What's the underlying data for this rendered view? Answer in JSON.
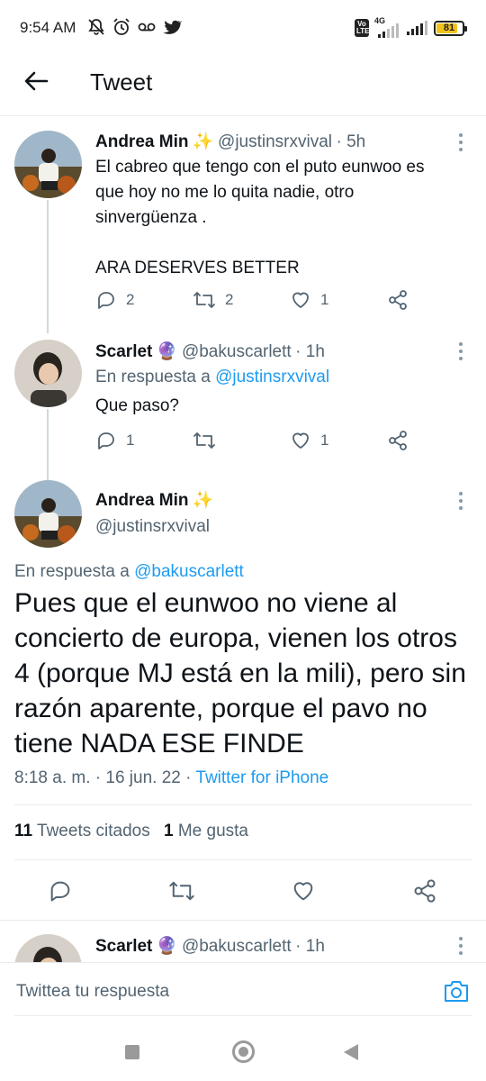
{
  "status_bar": {
    "time": "9:54 AM",
    "network": "4G",
    "volte": "Vo LTE",
    "battery": "81"
  },
  "header": {
    "title": "Tweet"
  },
  "tweets": [
    {
      "name": "Andrea Min",
      "emoji": "✨",
      "handle": "@justinsrxvival",
      "time": "· 5h",
      "lines": [
        "El cabreo que tengo con el puto eunwoo es",
        "que hoy no me lo quita nadie, otro",
        "sinvergüenza ."
      ],
      "extra": "ARA DESERVES BETTER",
      "replies": "2",
      "retweets": "2",
      "likes": "1"
    },
    {
      "name": "Scarlet",
      "emoji": "🔮",
      "handle": "@bakuscarlett",
      "time": "· 1h",
      "reply_prefix": "En respuesta a",
      "reply_to": "@justinsrxvival",
      "text": "Que paso?",
      "replies": "1",
      "retweets": "",
      "likes": "1"
    }
  ],
  "main_tweet": {
    "name": "Andrea Min",
    "emoji": "✨",
    "handle": "@justinsrxvival",
    "reply_prefix": "En respuesta a",
    "reply_to": "@bakuscarlett",
    "lines": [
      "Pues que el eunwoo no viene al",
      "concierto de europa, vienen los otros",
      "4 (porque MJ está en la mili), pero sin",
      "razón aparente, porque el pavo no",
      "tiene NADA ESE FINDE"
    ],
    "timestamp": "8:18 a. m. · 16 jun. 22 ·",
    "source": "Twitter for iPhone",
    "quote_count": "11",
    "quote_label": "Tweets citados",
    "like_count": "1",
    "like_label": "Me gusta"
  },
  "next_reply": {
    "name": "Scarlet",
    "emoji": "🔮",
    "handle": "@bakuscarlett",
    "time": "· 1h"
  },
  "compose": {
    "placeholder": "Twittea tu respuesta"
  },
  "colors": {
    "link": "#1d9bf0",
    "muted": "#536471",
    "battery": "#f2c21b"
  }
}
